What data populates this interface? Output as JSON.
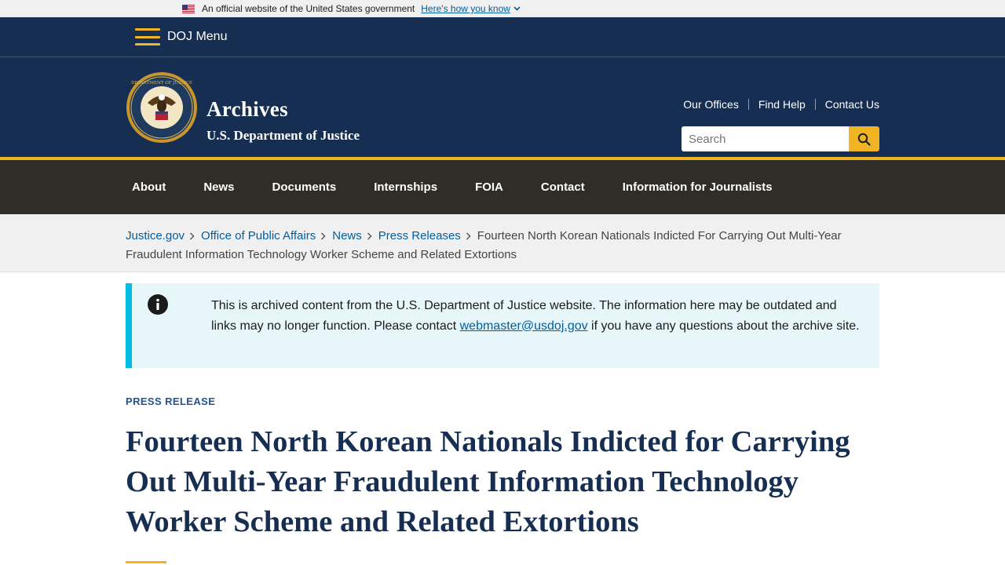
{
  "gov_banner": {
    "text": "An official website of the United States government",
    "link": "Here's how you know",
    "icon": "us-flag-icon"
  },
  "header": {
    "menu_label": "DOJ Menu",
    "site_title": "Archives",
    "site_subtitle": "U.S. Department of Justice",
    "utility_links": [
      "Our Offices",
      "Find Help",
      "Contact Us"
    ],
    "search_placeholder": "Search",
    "colors": {
      "navy": "#162e51",
      "gold": "#f1b523"
    }
  },
  "nav": {
    "items": [
      "About",
      "News",
      "Documents",
      "Internships",
      "FOIA",
      "Contact",
      "Information for Journalists"
    ]
  },
  "breadcrumb": {
    "links": [
      "Justice.gov",
      "Office of Public Affairs",
      "News",
      "Press Releases"
    ],
    "current": "Fourteen North Korean Nationals Indicted For Carrying Out Multi-Year Fraudulent Information Technology Worker Scheme and Related Extortions"
  },
  "alert": {
    "text_before": "This is archived content from the U.S. Department of Justice website. The information here may be outdated and links may no longer function. Please contact ",
    "link": "webmaster@usdoj.gov",
    "text_after": " if you have any questions about the archive site.",
    "accent": "#00bde3"
  },
  "article": {
    "eyebrow": "PRESS RELEASE",
    "title": "Fourteen North Korean Nationals Indicted for Carrying Out Multi-Year Fraudulent Information Technology Worker Scheme and Related Extortions"
  }
}
